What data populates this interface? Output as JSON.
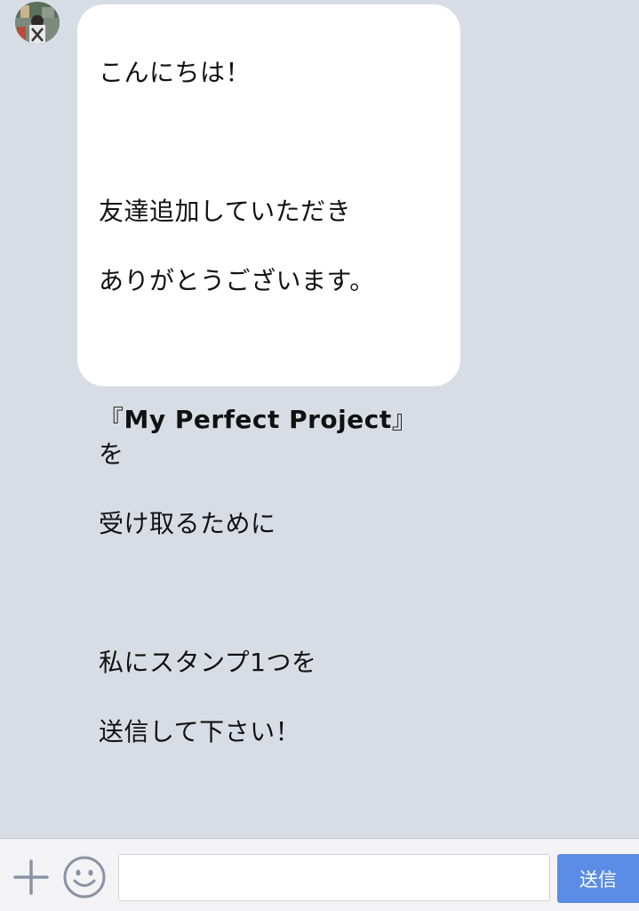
{
  "colors": {
    "chat_background": "#d8dde5",
    "bubble_background": "#ffffff",
    "send_button": "#5b8ce6",
    "input_bar": "#f3f3f5",
    "icon": "#8a93a3"
  },
  "chat": {
    "sender_avatar_icon": "avatar-photo",
    "message": {
      "line1": "こんにちは！",
      "line2": "友達追加していただき",
      "line3": "ありがとうございます。",
      "line4_open": "『",
      "line4_bold": "My Perfect Project",
      "line4_close": "』を",
      "line5": "受け取るために",
      "line6": "私にスタンプ1つを",
      "line7": "送信して下さい！"
    }
  },
  "input_bar": {
    "plus_icon": "plus-icon",
    "emoji_icon": "smiley-icon",
    "input_value": "",
    "send_label": "送信"
  }
}
